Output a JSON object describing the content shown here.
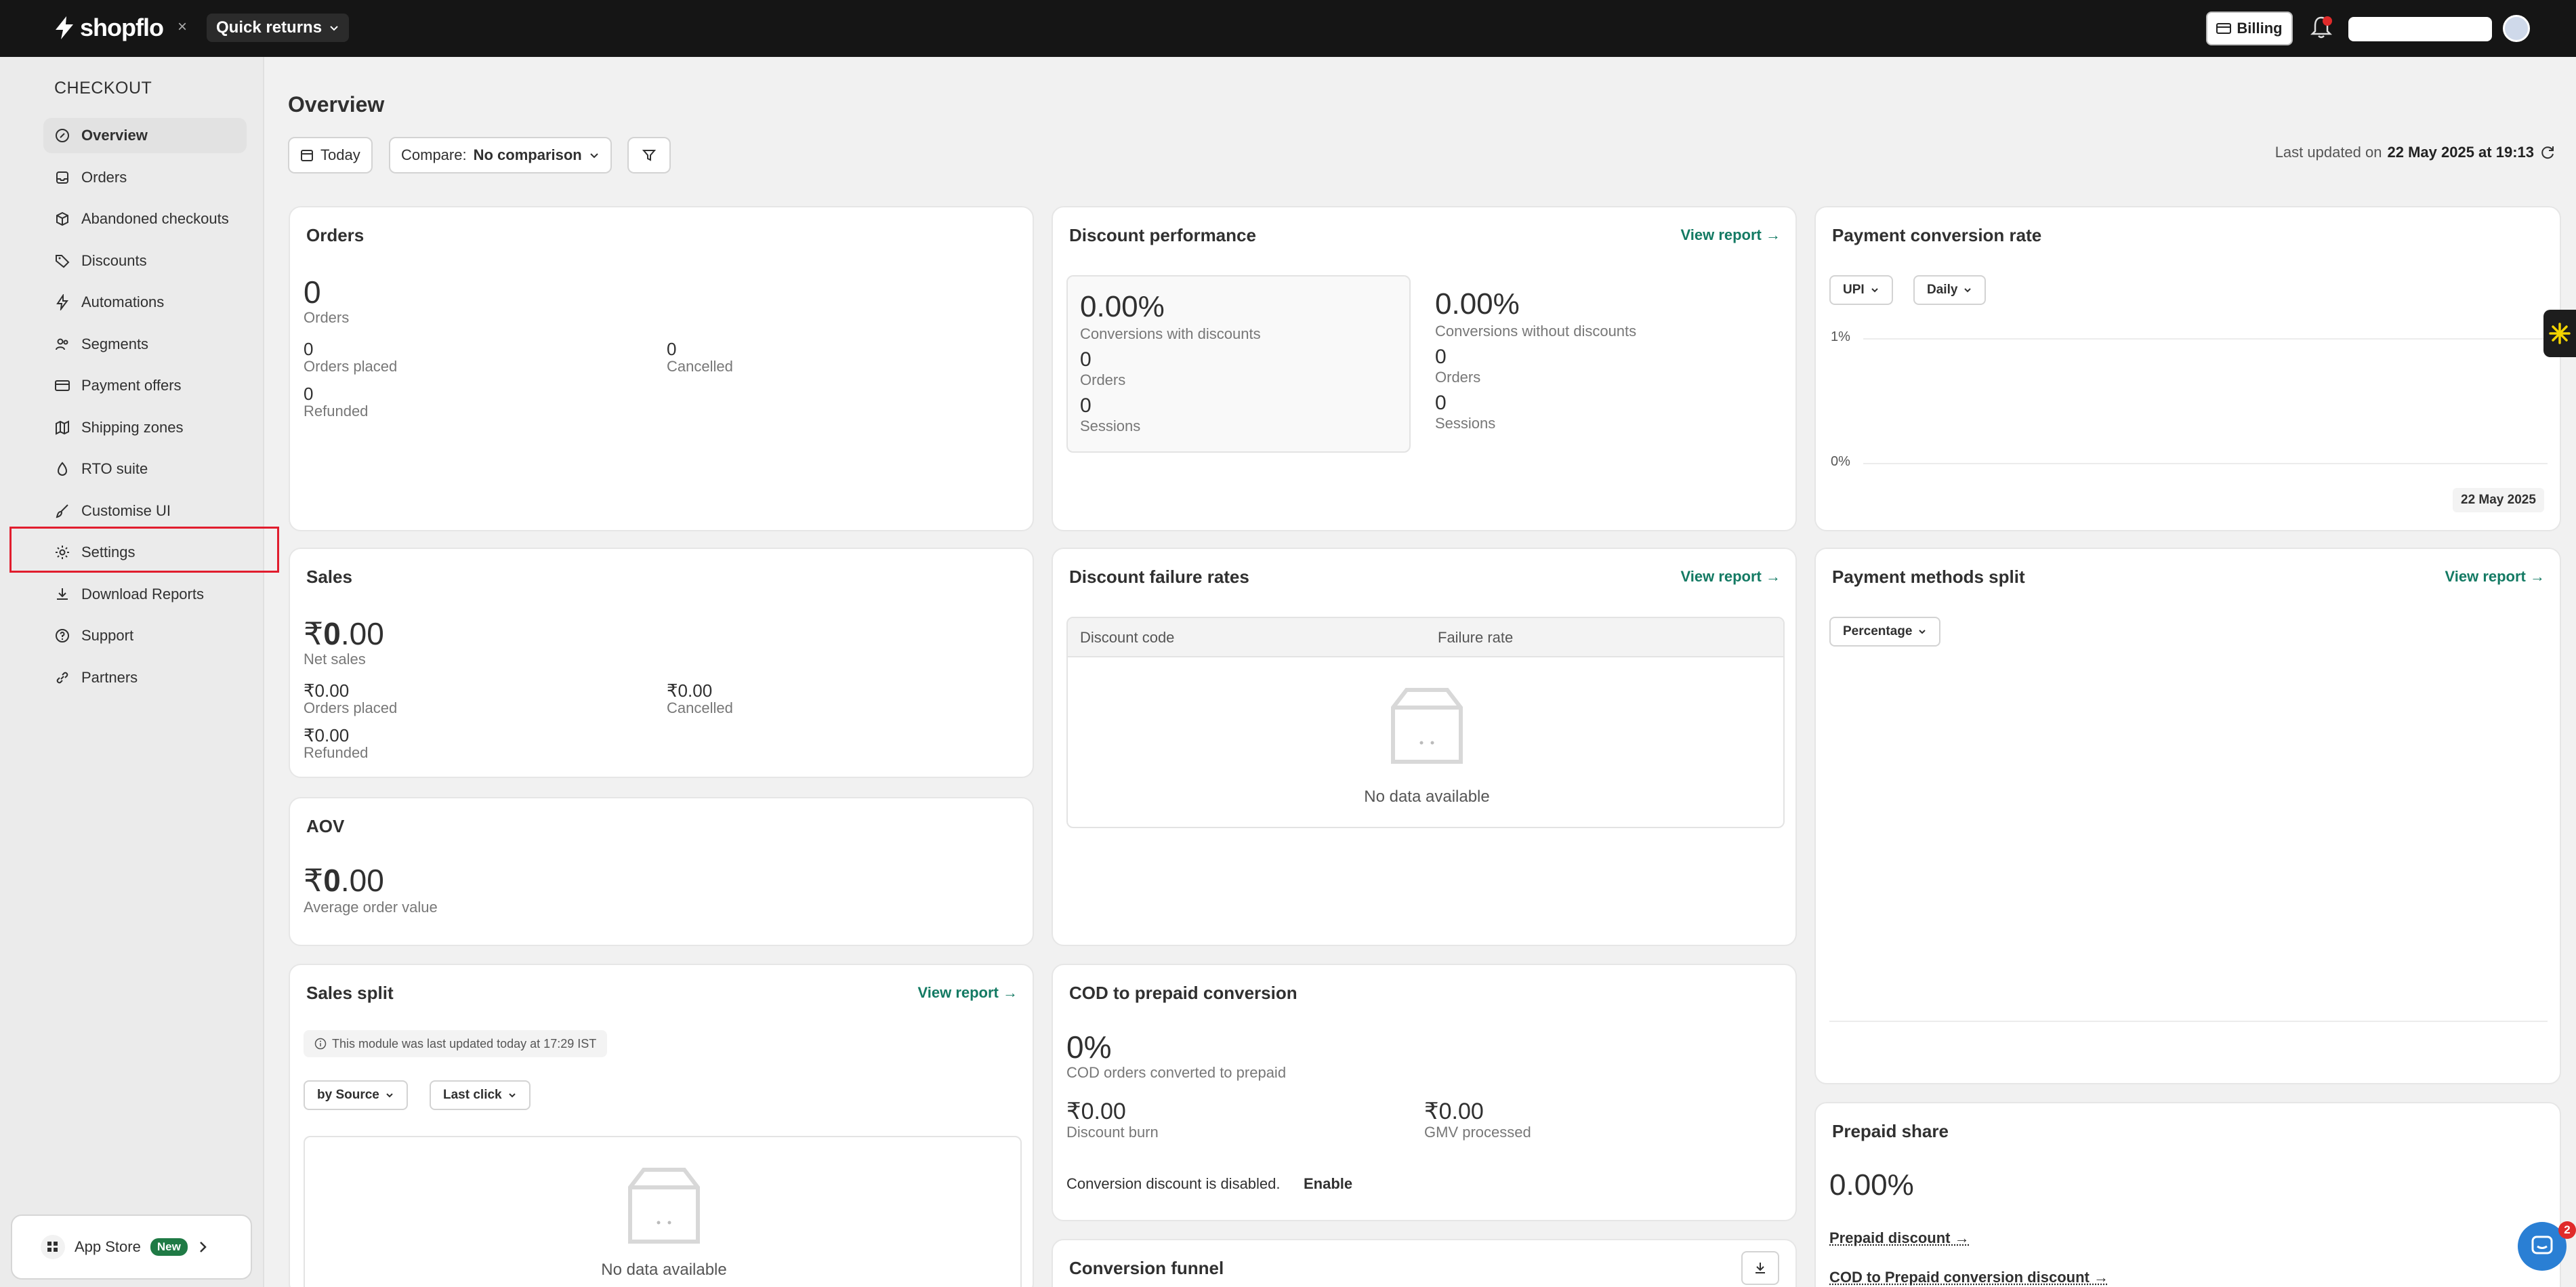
{
  "topbar": {
    "brand": "shopflo",
    "close_glyph": "×",
    "store_name": "Quick returns",
    "billing_label": "Billing"
  },
  "sidebar": {
    "heading": "CHECKOUT",
    "items": [
      {
        "label": "Overview",
        "icon": "overview-icon"
      },
      {
        "label": "Orders",
        "icon": "orders-icon"
      },
      {
        "label": "Abandoned checkouts",
        "icon": "abandoned-checkouts-icon"
      },
      {
        "label": "Discounts",
        "icon": "discount-tag-icon"
      },
      {
        "label": "Automations",
        "icon": "lightning-icon"
      },
      {
        "label": "Segments",
        "icon": "segments-icon"
      },
      {
        "label": "Payment offers",
        "icon": "card-icon"
      },
      {
        "label": "Shipping zones",
        "icon": "map-icon"
      },
      {
        "label": "RTO suite",
        "icon": "rto-icon"
      },
      {
        "label": "Customise UI",
        "icon": "brush-icon"
      },
      {
        "label": "Settings",
        "icon": "gear-icon"
      },
      {
        "label": "Download Reports",
        "icon": "download-icon"
      },
      {
        "label": "Support",
        "icon": "help-icon"
      },
      {
        "label": "Partners",
        "icon": "link-icon"
      }
    ],
    "app_store": {
      "label": "App Store",
      "badge": "New"
    }
  },
  "header": {
    "title": "Overview",
    "date_button": "Today",
    "compare_prefix": "Compare:",
    "compare_value": "No comparison",
    "last_updated_prefix": "Last updated on",
    "last_updated_value": "22 May 2025 at 19:13"
  },
  "orders": {
    "title": "Orders",
    "total": "0",
    "total_label": "Orders",
    "placed": "0",
    "placed_label": "Orders placed",
    "cancelled": "0",
    "cancelled_label": "Cancelled",
    "refunded": "0",
    "refunded_label": "Refunded"
  },
  "sales": {
    "title": "Sales",
    "currency": "₹",
    "total_int": "0",
    "total_dec": ".00",
    "total_label": "Net sales",
    "placed_cur": "₹",
    "placed": "0.00",
    "placed_label": "Orders placed",
    "cancelled_cur": "₹",
    "cancelled": "0.00",
    "cancelled_label": "Cancelled",
    "refunded_cur": "₹",
    "refunded": "0.00",
    "refunded_label": "Refunded"
  },
  "aov": {
    "title": "AOV",
    "currency": "₹",
    "value_int": "0",
    "value_dec": ".00",
    "label": "Average order value"
  },
  "sales_split": {
    "title": "Sales split",
    "view_report": "View report →",
    "note": "This module was last updated today at 17:29 IST",
    "filter1": "by Source",
    "filter2": "Last click",
    "empty": "No data available"
  },
  "discount_performance": {
    "title": "Discount performance",
    "view_report": "View report →",
    "with": {
      "rate": "0.00%",
      "rate_label": "Conversions with discounts",
      "orders": "0",
      "orders_label": "Orders",
      "sessions": "0",
      "sessions_label": "Sessions"
    },
    "without": {
      "rate": "0.00%",
      "rate_label": "Conversions without discounts",
      "orders": "0",
      "orders_label": "Orders",
      "sessions": "0",
      "sessions_label": "Sessions"
    }
  },
  "discount_failure": {
    "title": "Discount failure rates",
    "view_report": "View report →",
    "col1": "Discount code",
    "col2": "Failure rate",
    "empty": "No data available"
  },
  "cod": {
    "title": "COD to prepaid conversion",
    "rate": "0%",
    "rate_label": "COD orders converted to prepaid",
    "burn": "₹0.00",
    "burn_label": "Discount burn",
    "gmv": "₹0.00",
    "gmv_label": "GMV processed",
    "disabled_text": "Conversion discount is disabled.",
    "enable": "Enable"
  },
  "funnel": {
    "title": "Conversion funnel"
  },
  "payment_conversion": {
    "title": "Payment conversion rate",
    "filter1": "UPI",
    "filter2": "Daily",
    "y_top": "1%",
    "y_bottom": "0%",
    "date_chip": "22 May 2025"
  },
  "payment_split": {
    "title": "Payment methods split",
    "view_report": "View report →",
    "filter": "Percentage"
  },
  "prepaid": {
    "title": "Prepaid share",
    "value": "0.00%",
    "link1": "Prepaid discount →",
    "link2": "COD to Prepaid conversion discount →"
  },
  "chat": {
    "badge": "2"
  },
  "colors": {
    "accent_green": "#137a63",
    "highlight_red": "#e11d2e",
    "topbar": "#151515"
  }
}
